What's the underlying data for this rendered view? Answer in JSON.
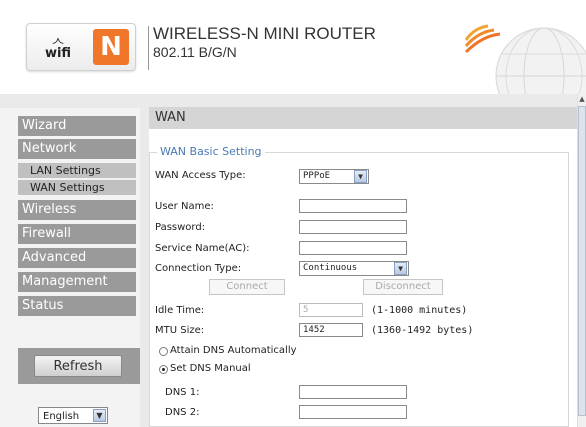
{
  "header": {
    "title": "WIRELESS-N MINI ROUTER",
    "subtitle": "802.11 B/G/N",
    "logo_wifi": "wifi",
    "logo_n": "N"
  },
  "sidebar": {
    "items": [
      {
        "label": "Wizard"
      },
      {
        "label": "Network"
      },
      {
        "label": "LAN Settings"
      },
      {
        "label": "WAN Settings"
      },
      {
        "label": "Wireless"
      },
      {
        "label": "Firewall"
      },
      {
        "label": "Advanced"
      },
      {
        "label": "Management"
      },
      {
        "label": "Status"
      }
    ],
    "refresh_label": "Refresh",
    "language": "English"
  },
  "main": {
    "section_title": "WAN",
    "group_title": "WAN Basic Setting",
    "fields": {
      "wan_access_type": {
        "label": "WAN Access Type:",
        "value": "PPPoE"
      },
      "user_name": {
        "label": "User Name:",
        "value": ""
      },
      "password": {
        "label": "Password:",
        "value": ""
      },
      "service_name": {
        "label": "Service Name(AC):",
        "value": ""
      },
      "connection_type": {
        "label": "Connection Type:",
        "value": "Continuous"
      },
      "connect_label": "Connect",
      "disconnect_label": "Disconnect",
      "idle_time": {
        "label": "Idle Time:",
        "value": "5",
        "hint": "(1-1000 minutes)"
      },
      "mtu_size": {
        "label": "MTU Size:",
        "value": "1452",
        "hint": "(1360-1492 bytes)"
      },
      "dns_auto_label": "Attain DNS Automatically",
      "dns_manual_label": "Set DNS Manual",
      "dns1": {
        "label": "DNS 1:",
        "value": ""
      },
      "dns2": {
        "label": "DNS 2:",
        "value": ""
      }
    }
  },
  "colors": {
    "nav_bg": "#9a9a9a",
    "accent_orange": "#f0762a",
    "legend_blue": "#4a7ab3"
  }
}
